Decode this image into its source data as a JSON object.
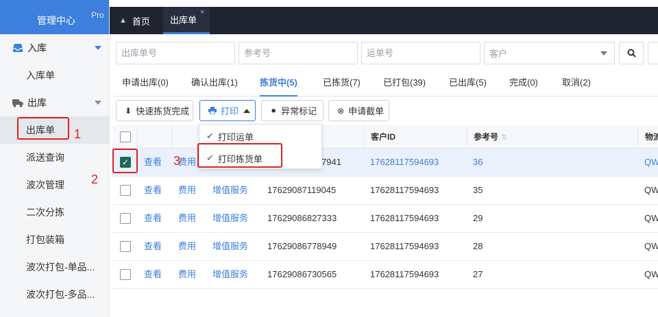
{
  "brand": {
    "title": "管理中心",
    "badge": "Pro"
  },
  "sidebar": {
    "groups": [
      {
        "label": "入库",
        "items": [
          {
            "label": "入库单"
          }
        ]
      },
      {
        "label": "出库",
        "items": [
          {
            "label": "出库单"
          },
          {
            "label": "派送查询"
          },
          {
            "label": "波次管理"
          },
          {
            "label": "二次分拣"
          },
          {
            "label": "打包装箱"
          },
          {
            "label": "波次打包-单品..."
          },
          {
            "label": "波次打包-多品..."
          }
        ]
      }
    ]
  },
  "top_tabs": [
    {
      "label": "首页"
    },
    {
      "label": "出库单",
      "close": "×"
    }
  ],
  "search": {
    "order_no": "出库单号",
    "reference_no": "参考号",
    "waybill_no": "运单号",
    "customer": "客户"
  },
  "status_tabs": [
    {
      "label": "申请出库(0)"
    },
    {
      "label": "确认出库(1)"
    },
    {
      "label": "拣货中(5)"
    },
    {
      "label": "已拣货(7)"
    },
    {
      "label": "已打包(39)"
    },
    {
      "label": "已出库(5)"
    },
    {
      "label": "完成(0)"
    },
    {
      "label": "取消(2)"
    }
  ],
  "actions": {
    "quick_pick": "快速拣货完成",
    "print": "打印",
    "exception_mark": "异常标记",
    "request_cut": "申请截单"
  },
  "print_menu": [
    {
      "label": "打印运单"
    },
    {
      "label": "打印拣货单"
    }
  ],
  "table": {
    "headers": {
      "customer_id": "客户ID",
      "reference": "参考号",
      "logistics": "物流"
    },
    "row_links": {
      "view": "查看",
      "fee": "费用",
      "vas": "增值服务"
    },
    "rows": [
      {
        "order_id": "7941",
        "customer_id": "17628117594693",
        "reference": "36",
        "logistics": "QW",
        "checked": true
      },
      {
        "order_id": "17629087119045",
        "customer_id": "17628117594693",
        "reference": "35",
        "logistics": "QW",
        "checked": false
      },
      {
        "order_id": "17629086827333",
        "customer_id": "17628117594693",
        "reference": "29",
        "logistics": "QW",
        "checked": false
      },
      {
        "order_id": "17629086778949",
        "customer_id": "17628117594693",
        "reference": "28",
        "logistics": "QW",
        "checked": false
      },
      {
        "order_id": "17629086730565",
        "customer_id": "17628117594693",
        "reference": "27",
        "logistics": "QW",
        "checked": false
      }
    ]
  },
  "annotations": {
    "one": "1",
    "two": "2",
    "three": "3"
  },
  "colors": {
    "accent": "#3c7fdc",
    "topbar": "#1f2430",
    "annotation": "#e02020",
    "checked": "#1e6a5a"
  }
}
